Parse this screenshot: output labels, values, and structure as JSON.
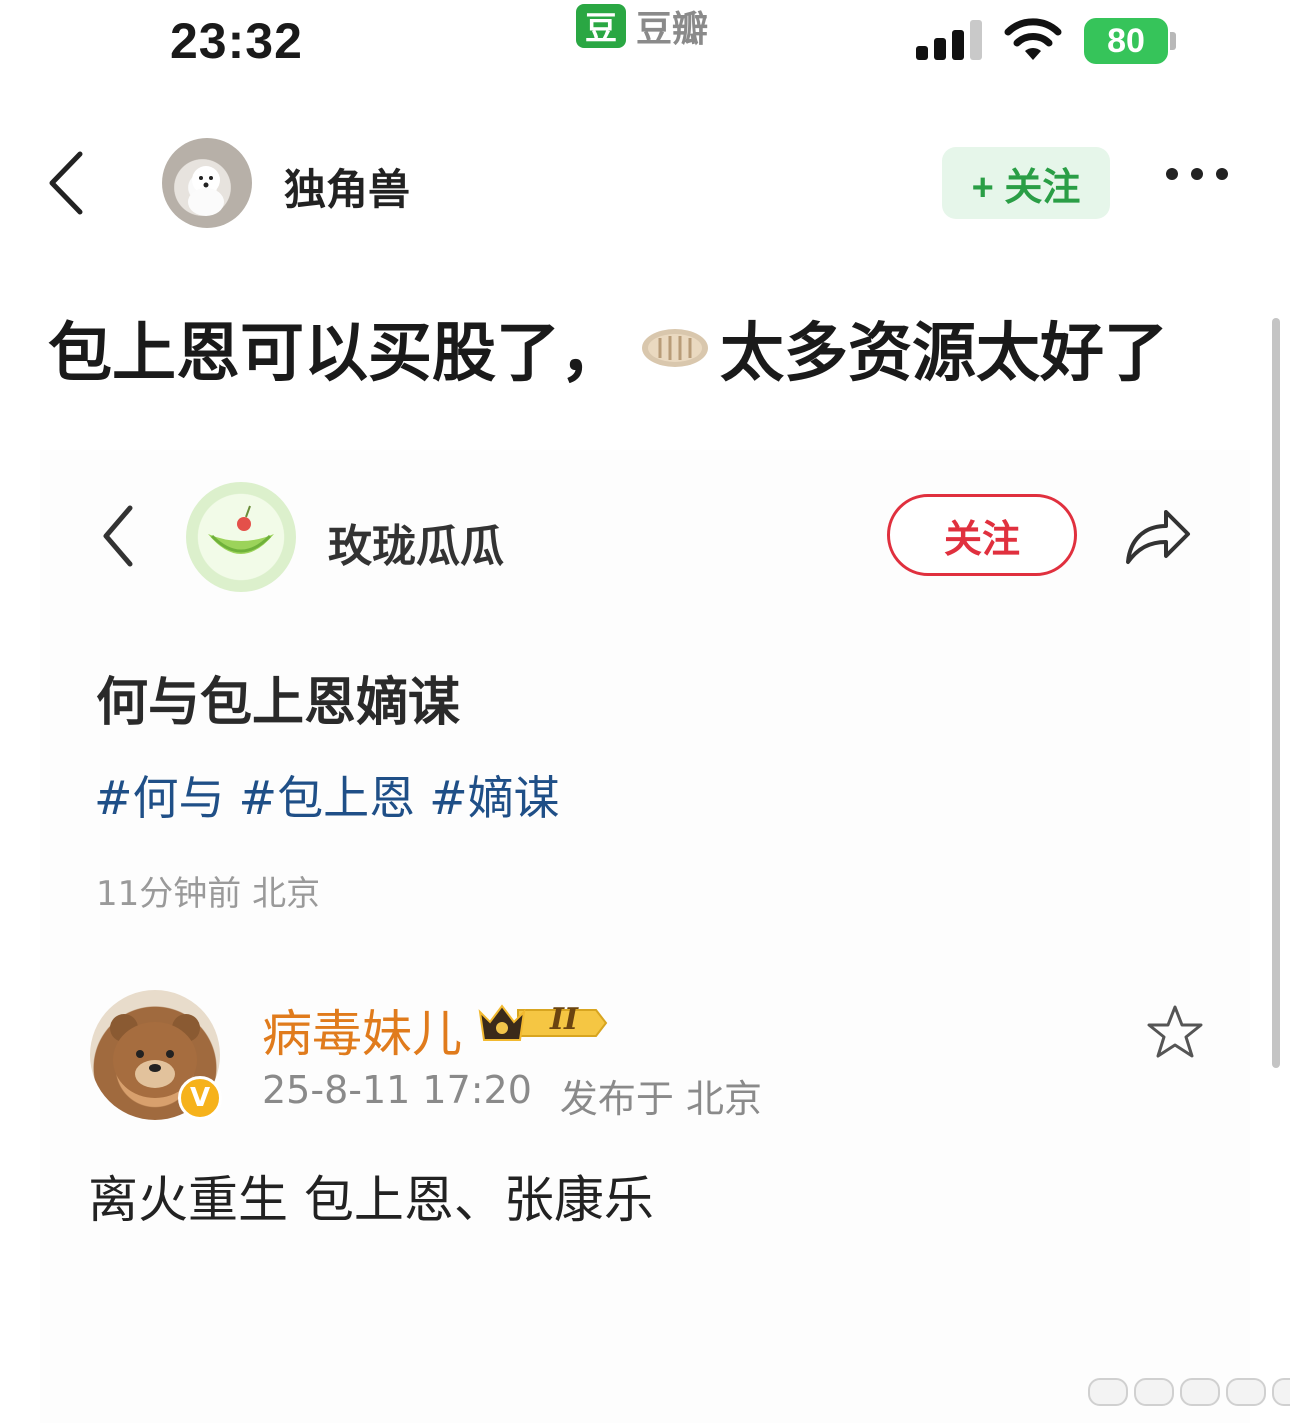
{
  "status_bar": {
    "time": "23:32",
    "app_logo_char": "豆",
    "app_name": "豆瓣",
    "battery": "80"
  },
  "header": {
    "username": "独角兽",
    "follow_label": "+ 关注"
  },
  "post": {
    "title_part1": "包上恩可以买股了，",
    "title_part2": "太多资源太好了"
  },
  "embedded": {
    "username": "玫珑瓜瓜",
    "follow_label": "关注",
    "title": "何与包上恩嫡谋",
    "tags": [
      "#何与",
      "#包上恩",
      "#嫡谋"
    ],
    "meta": "11分钟前 北京"
  },
  "comment": {
    "username": "病毒妹儿",
    "level": "II",
    "verified_mark": "V",
    "date": "25-8-11 17:20",
    "location": "发布于 北京",
    "text": "离火重生 包上恩、张康乐"
  },
  "colors": {
    "douban_green": "#2aa743",
    "follow_red": "#e0303e",
    "tag_blue": "#1f4f87",
    "username_orange": "#e07b1c"
  },
  "icons": [
    "back-icon",
    "more-icon",
    "share-icon",
    "star-icon",
    "wifi-icon",
    "signal-icon"
  ]
}
